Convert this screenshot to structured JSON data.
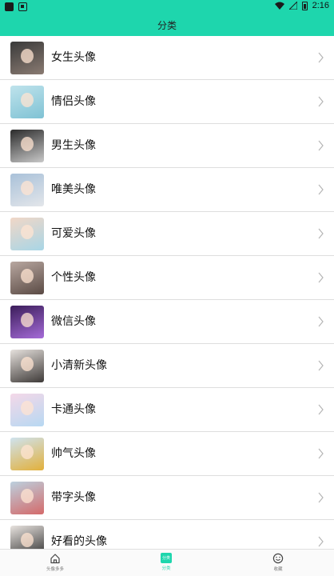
{
  "status_bar": {
    "time": "2:16"
  },
  "header": {
    "title": "分类"
  },
  "categories": [
    {
      "label": "女生头像",
      "thumb": [
        "#3a3a3a",
        "#8a7b72"
      ]
    },
    {
      "label": "情侣头像",
      "thumb": [
        "#bfe3ec",
        "#7fc2d4"
      ]
    },
    {
      "label": "男生头像",
      "thumb": [
        "#2b2b2b",
        "#c9c9c9"
      ]
    },
    {
      "label": "唯美头像",
      "thumb": [
        "#a9c1d9",
        "#e3e6ea"
      ]
    },
    {
      "label": "可爱头像",
      "thumb": [
        "#f1d7c7",
        "#a8d6e6"
      ]
    },
    {
      "label": "个性头像",
      "thumb": [
        "#b8a7a0",
        "#5a4a44"
      ]
    },
    {
      "label": "微信头像",
      "thumb": [
        "#3b1d5a",
        "#a56bd8"
      ]
    },
    {
      "label": "小清新头像",
      "thumb": [
        "#e6e1dd",
        "#3e3a38"
      ]
    },
    {
      "label": "卡通头像",
      "thumb": [
        "#f4d8e8",
        "#b7d8f2"
      ]
    },
    {
      "label": "帅气头像",
      "thumb": [
        "#cfe3ef",
        "#e2b03b"
      ]
    },
    {
      "label": "带字头像",
      "thumb": [
        "#bcd0de",
        "#d46a6a"
      ]
    },
    {
      "label": "好看的头像",
      "thumb": [
        "#e8e3df",
        "#2a2a2a"
      ]
    }
  ],
  "tabbar": {
    "tabs": [
      {
        "label": "头像多多",
        "icon": "home-icon"
      },
      {
        "label": "分类",
        "icon": "category-icon",
        "badge": "分类"
      },
      {
        "label": "收藏",
        "icon": "favorite-smile-icon"
      }
    ]
  },
  "colors": {
    "accent": "#1ed6ad"
  }
}
